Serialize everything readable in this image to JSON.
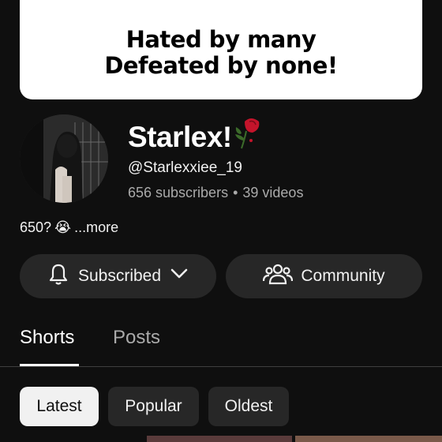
{
  "banner": {
    "line1": "Hated by many",
    "line2": "Defeated by none!"
  },
  "channel": {
    "name": "Starlex!",
    "handle": "@Starlexxiee_19",
    "subscribers": "656 subscribers",
    "separator": "•",
    "videos": "39 videos"
  },
  "description": {
    "text": "650?",
    "emoji": "😭",
    "more": "...more"
  },
  "actions": {
    "subscribe_label": "Subscribed",
    "community_label": "Community"
  },
  "tabs": [
    {
      "label": "Shorts",
      "active": true
    },
    {
      "label": "Posts",
      "active": false
    }
  ],
  "filters": [
    {
      "label": "Latest",
      "selected": true
    },
    {
      "label": "Popular",
      "selected": false
    },
    {
      "label": "Oldest",
      "selected": false
    }
  ],
  "colors": {
    "background": "#0f0f0f",
    "pill": "#272727",
    "text_secondary": "#aaaaaa",
    "rose": "#c4142b"
  },
  "icons": [
    "bell-icon",
    "chevron-down-icon",
    "community-icon",
    "rose-icon"
  ]
}
